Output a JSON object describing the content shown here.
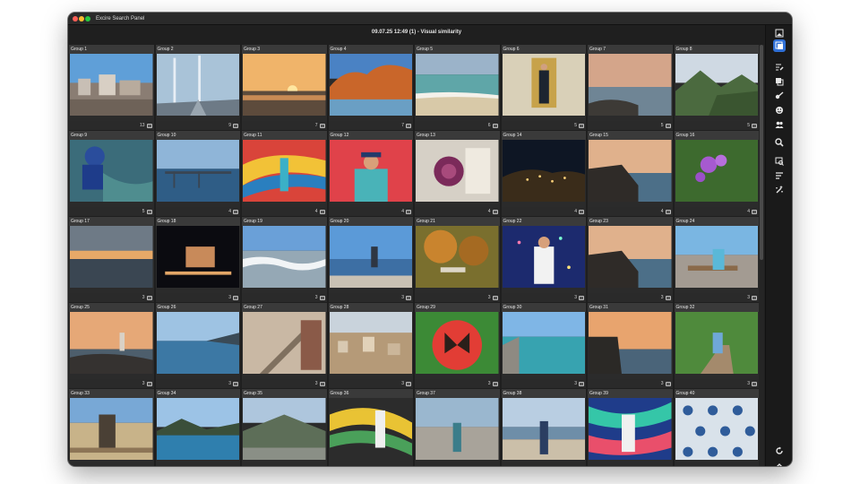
{
  "window": {
    "app_title": "Excire Search Panel",
    "subtitle": "09.07.25 12:49 (1) - Visual similarity"
  },
  "groups": [
    {
      "label": "Group 1",
      "count": "13",
      "scene": "city"
    },
    {
      "label": "Group 2",
      "count": "9",
      "scene": "bridge"
    },
    {
      "label": "Group 3",
      "count": "7",
      "scene": "sunset"
    },
    {
      "label": "Group 4",
      "count": "7",
      "scene": "rocks"
    },
    {
      "label": "Group 5",
      "count": "6",
      "scene": "beach"
    },
    {
      "label": "Group 6",
      "count": "5",
      "scene": "door"
    },
    {
      "label": "Group 7",
      "count": "5",
      "scene": "coast"
    },
    {
      "label": "Group 8",
      "count": "5",
      "scene": "mountains"
    },
    {
      "label": "Group 9",
      "count": "5",
      "scene": "diver"
    },
    {
      "label": "Group 10",
      "count": "4",
      "scene": "pier"
    },
    {
      "label": "Group 11",
      "count": "4",
      "scene": "mural"
    },
    {
      "label": "Group 12",
      "count": "4",
      "scene": "redwall"
    },
    {
      "label": "Group 13",
      "count": "4",
      "scene": "flower"
    },
    {
      "label": "Group 14",
      "count": "4",
      "scene": "night"
    },
    {
      "label": "Group 15",
      "count": "4",
      "scene": "cliff"
    },
    {
      "label": "Group 16",
      "count": "4",
      "scene": "lilac"
    },
    {
      "label": "Group 17",
      "count": "3",
      "scene": "seaset"
    },
    {
      "label": "Group 18",
      "count": "3",
      "scene": "nightbldg"
    },
    {
      "label": "Group 19",
      "count": "3",
      "scene": "waves"
    },
    {
      "label": "Group 20",
      "count": "3",
      "scene": "viewer"
    },
    {
      "label": "Group 21",
      "count": "3",
      "scene": "autumn"
    },
    {
      "label": "Group 22",
      "count": "3",
      "scene": "lights"
    },
    {
      "label": "Group 23",
      "count": "3",
      "scene": "cliff"
    },
    {
      "label": "Group 24",
      "count": "3",
      "scene": "bench"
    },
    {
      "label": "Group 25",
      "count": "3",
      "scene": "lighthouse"
    },
    {
      "label": "Group 26",
      "count": "3",
      "scene": "bay"
    },
    {
      "label": "Group 27",
      "count": "3",
      "scene": "stairs"
    },
    {
      "label": "Group 28",
      "count": "3",
      "scene": "town"
    },
    {
      "label": "Group 29",
      "count": "3",
      "scene": "butterfly"
    },
    {
      "label": "Group 30",
      "count": "3",
      "scene": "harbor"
    },
    {
      "label": "Group 31",
      "count": "3",
      "scene": "seacliff"
    },
    {
      "label": "Group 32",
      "count": "3",
      "scene": "boardwalk"
    },
    {
      "label": "Group 33",
      "count": "",
      "scene": "reeds"
    },
    {
      "label": "Group 34",
      "count": "",
      "scene": "lake"
    },
    {
      "label": "Group 35",
      "count": "",
      "scene": "valley"
    },
    {
      "label": "Group 36",
      "count": "",
      "scene": "graffiti"
    },
    {
      "label": "Group 37",
      "count": "",
      "scene": "street"
    },
    {
      "label": "Group 38",
      "count": "",
      "scene": "shore"
    },
    {
      "label": "Group 39",
      "count": "",
      "scene": "graffiti2"
    },
    {
      "label": "Group 40",
      "count": "",
      "scene": "tiles"
    }
  ],
  "toolbar": {
    "tools": [
      {
        "name": "single-view-tool",
        "icon": "single-image-icon",
        "active": false
      },
      {
        "name": "group-view-tool",
        "icon": "group-images-icon",
        "active": true
      },
      {
        "name": "keywords-tool",
        "icon": "tag-edit-icon",
        "active": false
      },
      {
        "name": "duplicates-tool",
        "icon": "duplicate-icon",
        "active": false
      },
      {
        "name": "keyword-search-tool",
        "icon": "key-icon",
        "active": false
      },
      {
        "name": "face-tool",
        "icon": "face-icon",
        "active": false
      },
      {
        "name": "people-tool",
        "icon": "people-icon",
        "active": false
      },
      {
        "name": "search-tool",
        "icon": "search-icon",
        "active": false
      },
      {
        "name": "similar-tool",
        "icon": "similarity-icon",
        "active": false
      },
      {
        "name": "sort-tool",
        "icon": "sort-icon",
        "active": false
      },
      {
        "name": "ai-tool",
        "icon": "magic-icon",
        "active": false
      },
      {
        "name": "refresh-tool",
        "icon": "refresh-icon",
        "active": false
      },
      {
        "name": "collapse-tool",
        "icon": "chevron-up-icon",
        "active": false
      }
    ]
  },
  "colors": {
    "accent": "#2f6fd6",
    "window_bg": "#1f1f1f",
    "cell_header": "#3a3a3a"
  }
}
